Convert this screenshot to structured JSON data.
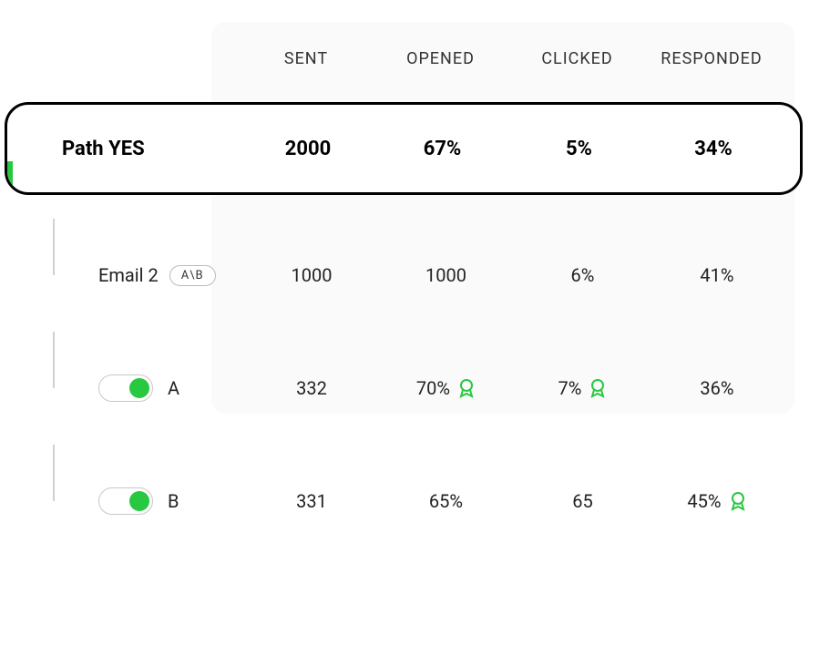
{
  "headers": {
    "sent": "SENT",
    "opened": "OPENED",
    "clicked": "CLICKED",
    "responded": "RESPONDED"
  },
  "path": {
    "label": "Path YES",
    "sent": "2000",
    "opened": "67%",
    "clicked": "5%",
    "responded": "34%"
  },
  "email_row": {
    "label": "Email 2",
    "badge": "A\\B",
    "sent": "1000",
    "opened": "1000",
    "clicked": "6%",
    "responded": "41%"
  },
  "variant_a": {
    "label": "A",
    "sent": "332",
    "opened": "70%",
    "opened_winner": true,
    "clicked": "7%",
    "clicked_winner": true,
    "responded": "36%",
    "responded_winner": false
  },
  "variant_b": {
    "label": "B",
    "sent": "331",
    "opened": "65%",
    "opened_winner": false,
    "clicked": "65",
    "clicked_winner": false,
    "responded": "45%",
    "responded_winner": true
  },
  "colors": {
    "accent": "#28C840"
  }
}
